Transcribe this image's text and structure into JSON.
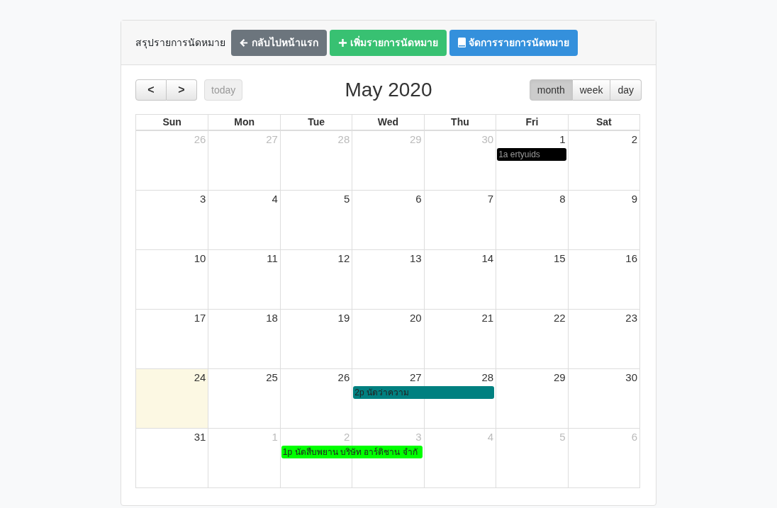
{
  "header": {
    "title": "สรุปรายการนัดหมาย",
    "buttons": [
      {
        "kind": "back",
        "label": "กลับไปหน้าแรก"
      },
      {
        "kind": "add",
        "label": "เพิ่มรายการนัดหมาย"
      },
      {
        "kind": "manage",
        "label": "จัดการรายการนัดหมาย"
      }
    ]
  },
  "toolbar": {
    "prev": "<",
    "next": ">",
    "today": {
      "label": "today",
      "disabled": true
    },
    "title": "May 2020",
    "views": [
      {
        "label": "month",
        "selected": true
      },
      {
        "label": "week",
        "selected": false
      },
      {
        "label": "day",
        "selected": false
      }
    ]
  },
  "weekdays": [
    "Sun",
    "Mon",
    "Tue",
    "Wed",
    "Thu",
    "Fri",
    "Sat"
  ],
  "weeks": [
    {
      "days": [
        {
          "day": "26",
          "other_month": true,
          "today": false
        },
        {
          "day": "27",
          "other_month": true,
          "today": false
        },
        {
          "day": "28",
          "other_month": true,
          "today": false
        },
        {
          "day": "29",
          "other_month": true,
          "today": false
        },
        {
          "day": "30",
          "other_month": true,
          "today": false
        },
        {
          "day": "1",
          "other_month": false,
          "today": false,
          "event": {
            "title": "1a ertyuids",
            "color": "#000000"
          }
        },
        {
          "day": "2",
          "other_month": false,
          "today": false
        }
      ]
    },
    {
      "days": [
        {
          "day": "3",
          "other_month": false,
          "today": false
        },
        {
          "day": "4",
          "other_month": false,
          "today": false
        },
        {
          "day": "5",
          "other_month": false,
          "today": false
        },
        {
          "day": "6",
          "other_month": false,
          "today": false
        },
        {
          "day": "7",
          "other_month": false,
          "today": false
        },
        {
          "day": "8",
          "other_month": false,
          "today": false
        },
        {
          "day": "9",
          "other_month": false,
          "today": false
        }
      ]
    },
    {
      "days": [
        {
          "day": "10",
          "other_month": false,
          "today": false
        },
        {
          "day": "11",
          "other_month": false,
          "today": false
        },
        {
          "day": "12",
          "other_month": false,
          "today": false
        },
        {
          "day": "13",
          "other_month": false,
          "today": false
        },
        {
          "day": "14",
          "other_month": false,
          "today": false
        },
        {
          "day": "15",
          "other_month": false,
          "today": false
        },
        {
          "day": "16",
          "other_month": false,
          "today": false
        }
      ]
    },
    {
      "days": [
        {
          "day": "17",
          "other_month": false,
          "today": false
        },
        {
          "day": "18",
          "other_month": false,
          "today": false
        },
        {
          "day": "19",
          "other_month": false,
          "today": false
        },
        {
          "day": "20",
          "other_month": false,
          "today": false
        },
        {
          "day": "21",
          "other_month": false,
          "today": false
        },
        {
          "day": "22",
          "other_month": false,
          "today": false
        },
        {
          "day": "23",
          "other_month": false,
          "today": false
        }
      ]
    },
    {
      "days": [
        {
          "day": "24",
          "other_month": false,
          "today": true
        },
        {
          "day": "25",
          "other_month": false,
          "today": false
        },
        {
          "day": "26",
          "other_month": false,
          "today": false
        },
        {
          "day": "27",
          "other_month": false,
          "today": false,
          "event": {
            "title": "2p นัดว่าความ",
            "color": "#008080"
          }
        },
        {
          "day": "28",
          "other_month": false,
          "today": false,
          "continues_event": true
        },
        {
          "day": "29",
          "other_month": false,
          "today": false
        },
        {
          "day": "30",
          "other_month": false,
          "today": false
        }
      ]
    },
    {
      "days": [
        {
          "day": "31",
          "other_month": false,
          "today": false
        },
        {
          "day": "1",
          "other_month": true,
          "today": false
        },
        {
          "day": "2",
          "other_month": true,
          "today": false,
          "event": {
            "title": "1p นัดสืบพยาน บริษัท อาร์ติชาน จำกั",
            "color": "#00ff00"
          }
        },
        {
          "day": "3",
          "other_month": true,
          "today": false,
          "continues_event": true
        },
        {
          "day": "4",
          "other_month": true,
          "today": false
        },
        {
          "day": "5",
          "other_month": true,
          "today": false
        },
        {
          "day": "6",
          "other_month": true,
          "today": false
        }
      ]
    }
  ]
}
